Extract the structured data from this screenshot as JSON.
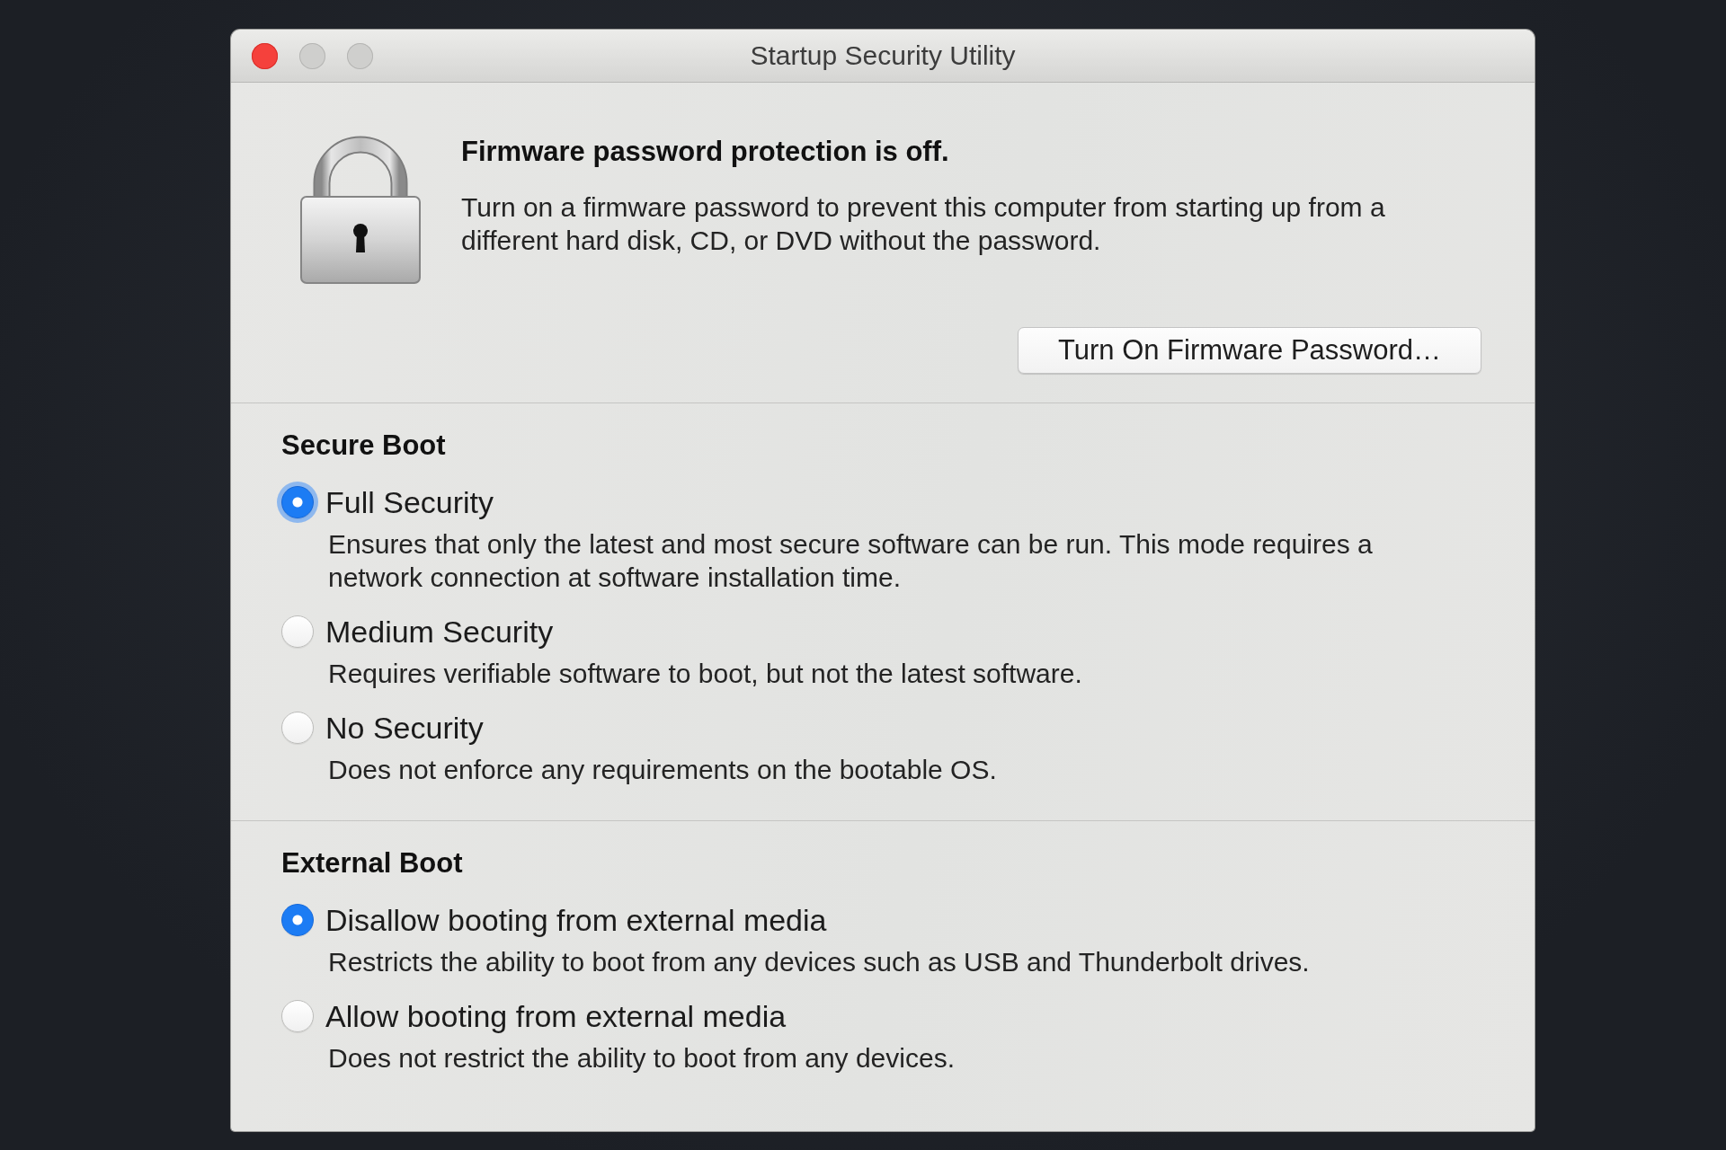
{
  "window": {
    "title": "Startup Security Utility",
    "controls": [
      {
        "kind": "close",
        "disabled": false
      },
      {
        "kind": "minimize",
        "disabled": true
      },
      {
        "kind": "zoom",
        "disabled": true
      }
    ]
  },
  "firmware_password": {
    "heading": "Firmware password protection is off.",
    "description": "Turn on a firmware password to prevent this computer from starting up from a different hard disk, CD, or DVD without the password.",
    "button": "Turn On Firmware Password…"
  },
  "sections": [
    {
      "title": "Secure Boot",
      "options": [
        {
          "label": "Full Security",
          "description": "Ensures that only the latest and most secure software can be run. This mode requires a network connection at software installation time.",
          "selected": true,
          "focused": true
        },
        {
          "label": "Medium Security",
          "description": "Requires verifiable software to boot, but not the latest software.",
          "selected": false,
          "focused": false
        },
        {
          "label": "No Security",
          "description": "Does not enforce any requirements on the bootable OS.",
          "selected": false,
          "focused": false
        }
      ]
    },
    {
      "title": "External Boot",
      "options": [
        {
          "label": "Disallow booting from external media",
          "description": "Restricts the ability to boot from any devices such as USB and Thunderbolt drives.",
          "selected": true,
          "focused": false
        },
        {
          "label": "Allow booting from external media",
          "description": "Does not restrict the ability to boot from any devices.",
          "selected": false,
          "focused": false
        }
      ]
    }
  ]
}
